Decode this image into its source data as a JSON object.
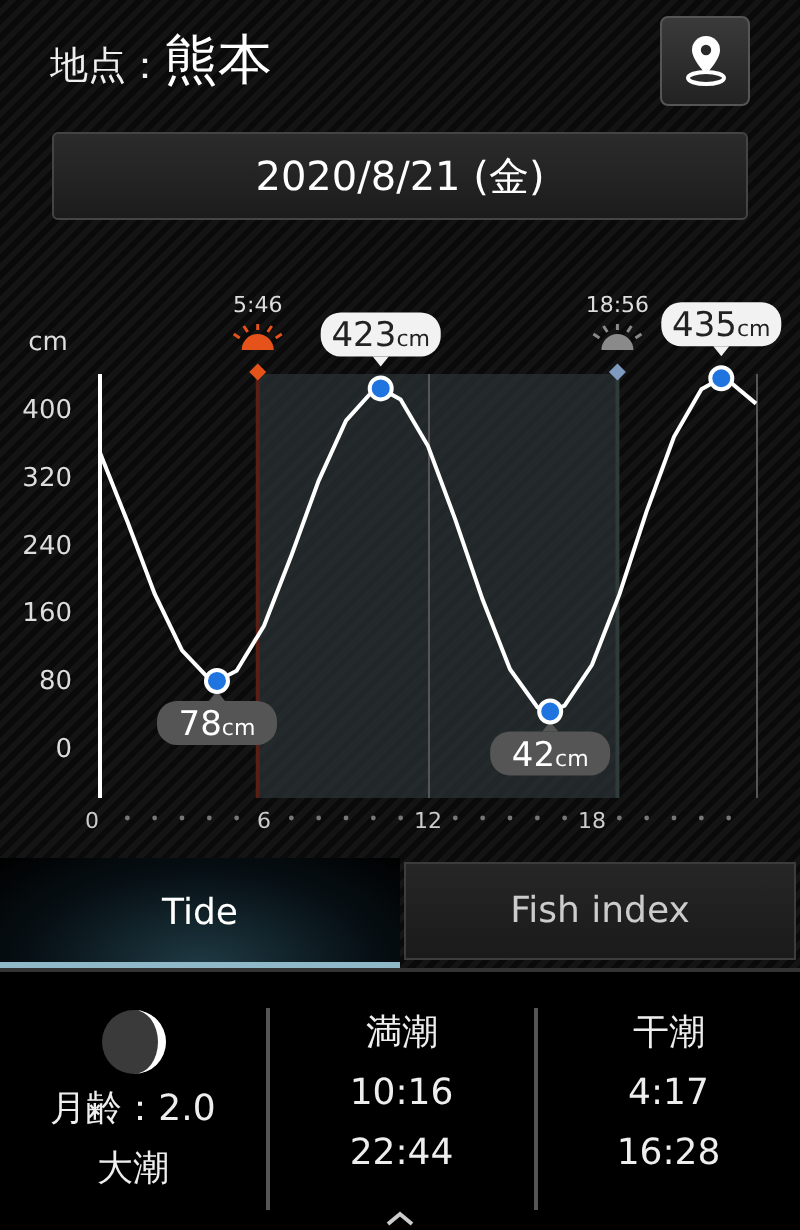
{
  "location": {
    "label": "地点：",
    "name": "熊本"
  },
  "date": "2020/8/21 (金)",
  "chart": {
    "chart_data": {
      "type": "line",
      "ylabel": "cm",
      "x": [
        0,
        1,
        2,
        3,
        4,
        4.28,
        5,
        6,
        7,
        8,
        9,
        10,
        10.27,
        11,
        12,
        13,
        14,
        15,
        16,
        16.47,
        17,
        18,
        19,
        20,
        21,
        22,
        22.73,
        23,
        24
      ],
      "series": [
        {
          "color": "#ffffff",
          "values": [
            347,
            266,
            181,
            114,
            80,
            78,
            90,
            143,
            226,
            314,
            385,
            421,
            423,
            410,
            355,
            268,
            174,
            92,
            47,
            42,
            49,
            97,
            180,
            278,
            366,
            422,
            435,
            432,
            405
          ]
        }
      ],
      "xlim": [
        0,
        24
      ],
      "ylim": [
        -60,
        440
      ],
      "xticks": [
        0,
        6,
        12,
        18
      ],
      "yticks": [
        0,
        80,
        160,
        240,
        320,
        400
      ],
      "bands": [
        {
          "axis": "x",
          "from": 5.77,
          "to": 18.93
        }
      ],
      "ref_lines": [
        {
          "axis": "x",
          "value": 5.77
        },
        {
          "axis": "x",
          "value": 18.93
        }
      ],
      "annotations": [
        "5:46",
        "18:56",
        {
          "x": 4.28,
          "y": 78,
          "text": "78cm"
        },
        {
          "x": 10.27,
          "y": 423,
          "text": "423cm"
        },
        {
          "x": 16.47,
          "y": 42,
          "text": "42cm"
        },
        {
          "x": 22.73,
          "y": 435,
          "text": "435cm"
        }
      ]
    }
  },
  "tabs": [
    {
      "label": "Tide",
      "selected": true
    },
    {
      "label": "Fish index",
      "selected": false
    }
  ],
  "summary": {
    "moon": {
      "age": "月齢：2.0",
      "tide_name": "大潮"
    },
    "columns": [
      {
        "heading": "満潮",
        "times": [
          "10:16",
          "22:44"
        ]
      },
      {
        "heading": "干潮",
        "times": [
          "4:17",
          "16:28"
        ]
      }
    ]
  }
}
